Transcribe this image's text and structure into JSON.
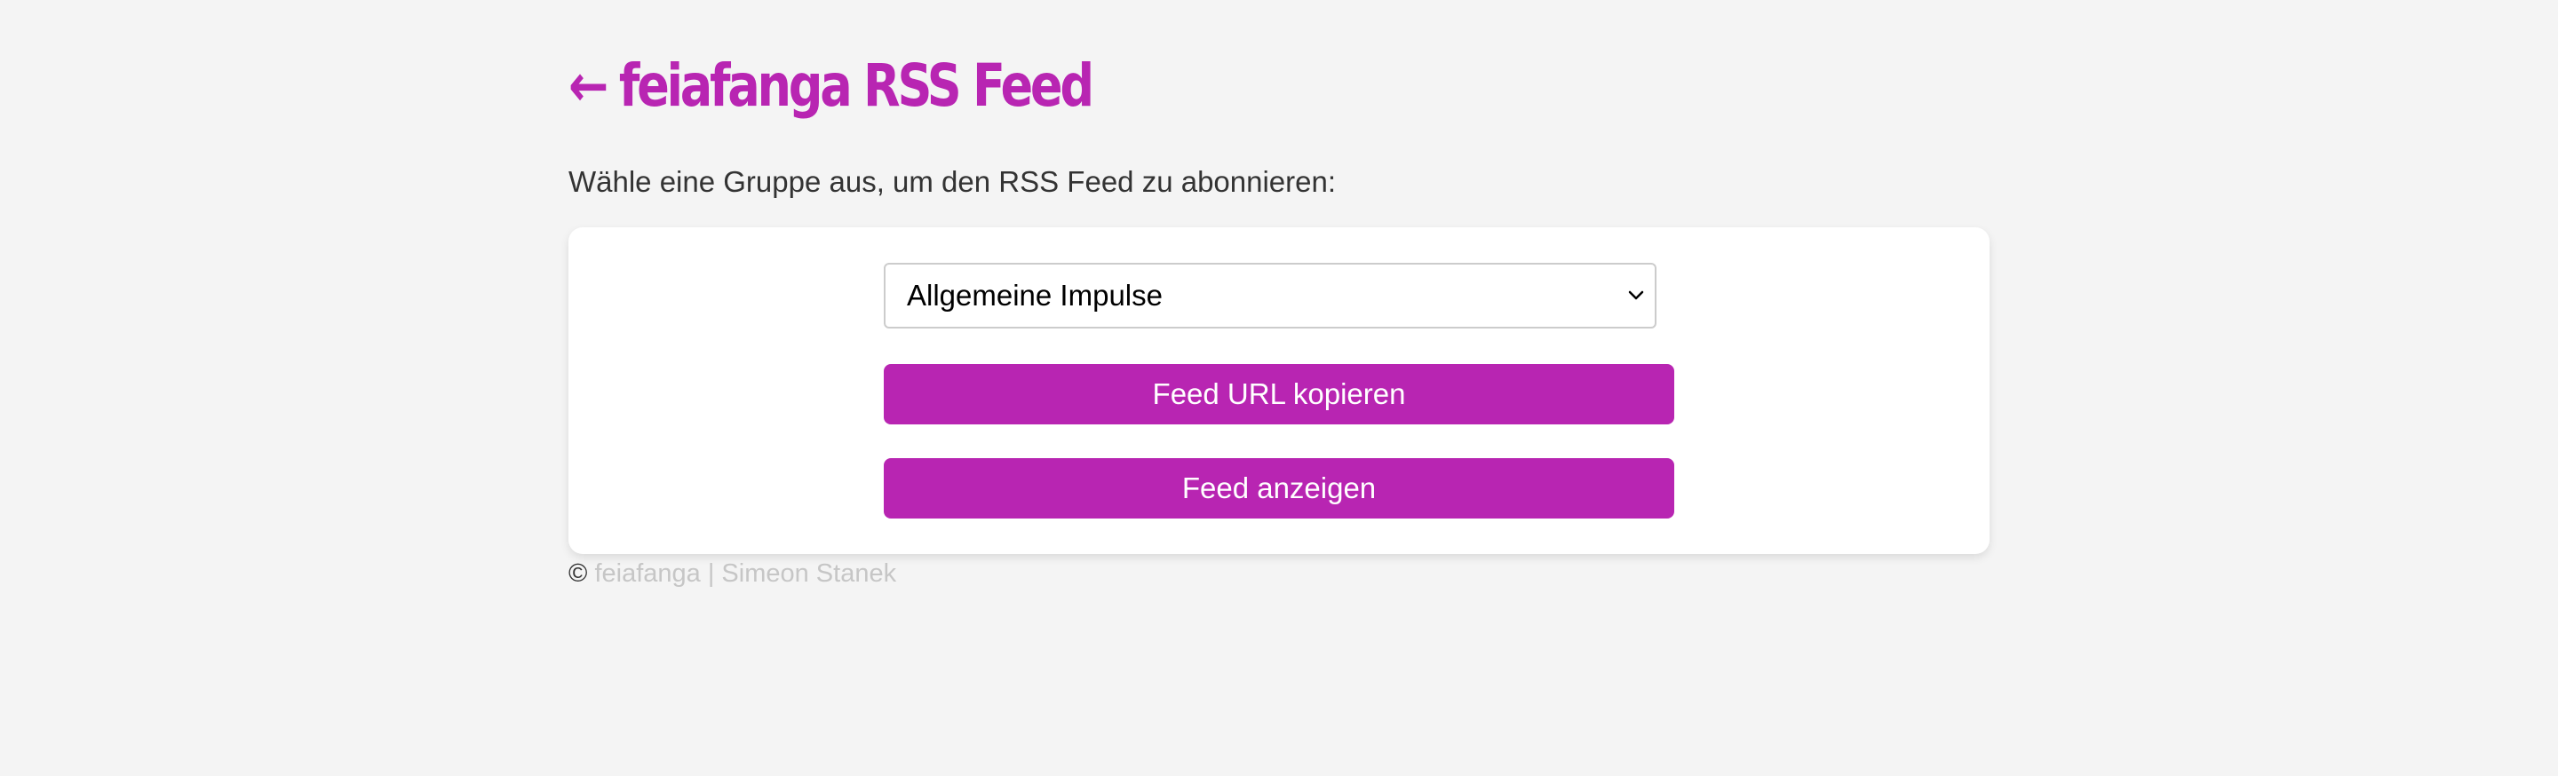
{
  "header": {
    "back_arrow": "←",
    "title": "feiafanga RSS Feed"
  },
  "intro": {
    "text": "Wähle eine Gruppe aus, um den RSS Feed zu abonnieren:"
  },
  "form": {
    "group_select": {
      "selected": "Allgemeine Impulse"
    },
    "copy_button_label": "Feed URL kopieren",
    "show_button_label": "Feed anzeigen"
  },
  "footer": {
    "symbol": "©",
    "author_link": "feiafanga | Simeon Stanek"
  },
  "colors": {
    "accent": "#b825b2",
    "background": "#f4f4f4",
    "card": "#ffffff",
    "text": "#333333",
    "footer_link": "#c6c6c6"
  },
  "icons": {
    "back": "back-arrow-icon",
    "dropdown": "chevron-down-icon"
  }
}
